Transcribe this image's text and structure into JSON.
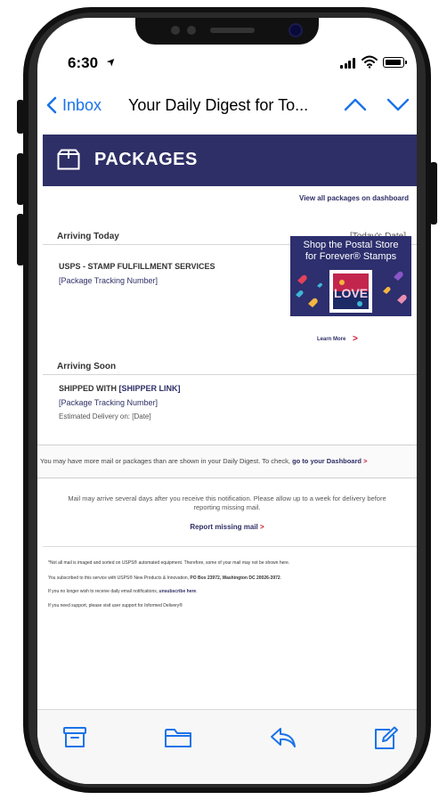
{
  "status_bar": {
    "time": "6:30",
    "location_glyph": "➤"
  },
  "nav": {
    "back_label": "Inbox",
    "title": "Your Daily Digest for To...",
    "icons": [
      "chevron-left-icon",
      "chevron-up-icon",
      "chevron-down-icon"
    ]
  },
  "email": {
    "banner_title": "PACKAGES",
    "view_all": "View all packages on dashboard",
    "arriving_today": {
      "label": "Arriving Today",
      "date": "[Today's Date]",
      "sender": "USPS - STAMP FULFILLMENT SERVICES",
      "tracking": "[Package Tracking Number]"
    },
    "ad": {
      "line1": "Shop the Postal Store",
      "line2": "for Forever® Stamps",
      "stamp_word": "LOVE",
      "learn_more": "Learn More",
      "chevron": ">"
    },
    "arriving_soon": {
      "label": "Arriving Soon",
      "shipped_prefix": "SHIPPED WITH ",
      "shipper_link": "[SHIPPER LINK]",
      "tracking": "[Package Tracking Number]",
      "delivery": "Estimated Delivery on: [Date]"
    },
    "digest_notice": {
      "text": "You may have more mail or packages than are shown in your Daily Digest. To check, ",
      "link": "go to your Dashboard",
      "chevron": ">"
    },
    "mail_notice_line1": "Mail may arrive several days after you receive this notification. Please allow up to a week for delivery before",
    "mail_notice_line2": "reporting missing mail.",
    "report_link": "Report missing mail",
    "report_chevron": ">",
    "fine_print": {
      "line1": "*Not all mail is imaged and sorted on USPS® automated equipment. Therefore, some of your mail may not be shown here.",
      "line2_prefix": "You subscribed to this service with USPS® New Products & Innovation, ",
      "line2_bold": "PO Box 23972, Washington DC 20026-3972",
      "line2_suffix": ".",
      "line3_prefix": "If you no longer wish to receive daily email notifications, ",
      "line3_link": "unsubscribe here",
      "line3_suffix": ".",
      "line4": "If you need support, please visit user support for Informed Delivery®"
    }
  },
  "toolbar": {
    "icons": [
      "archive-icon",
      "folder-icon",
      "reply-icon",
      "compose-icon"
    ]
  },
  "colors": {
    "ios_blue": "#1a73e8",
    "usps_navy": "#2e2f66",
    "usps_red": "#c8102e"
  }
}
